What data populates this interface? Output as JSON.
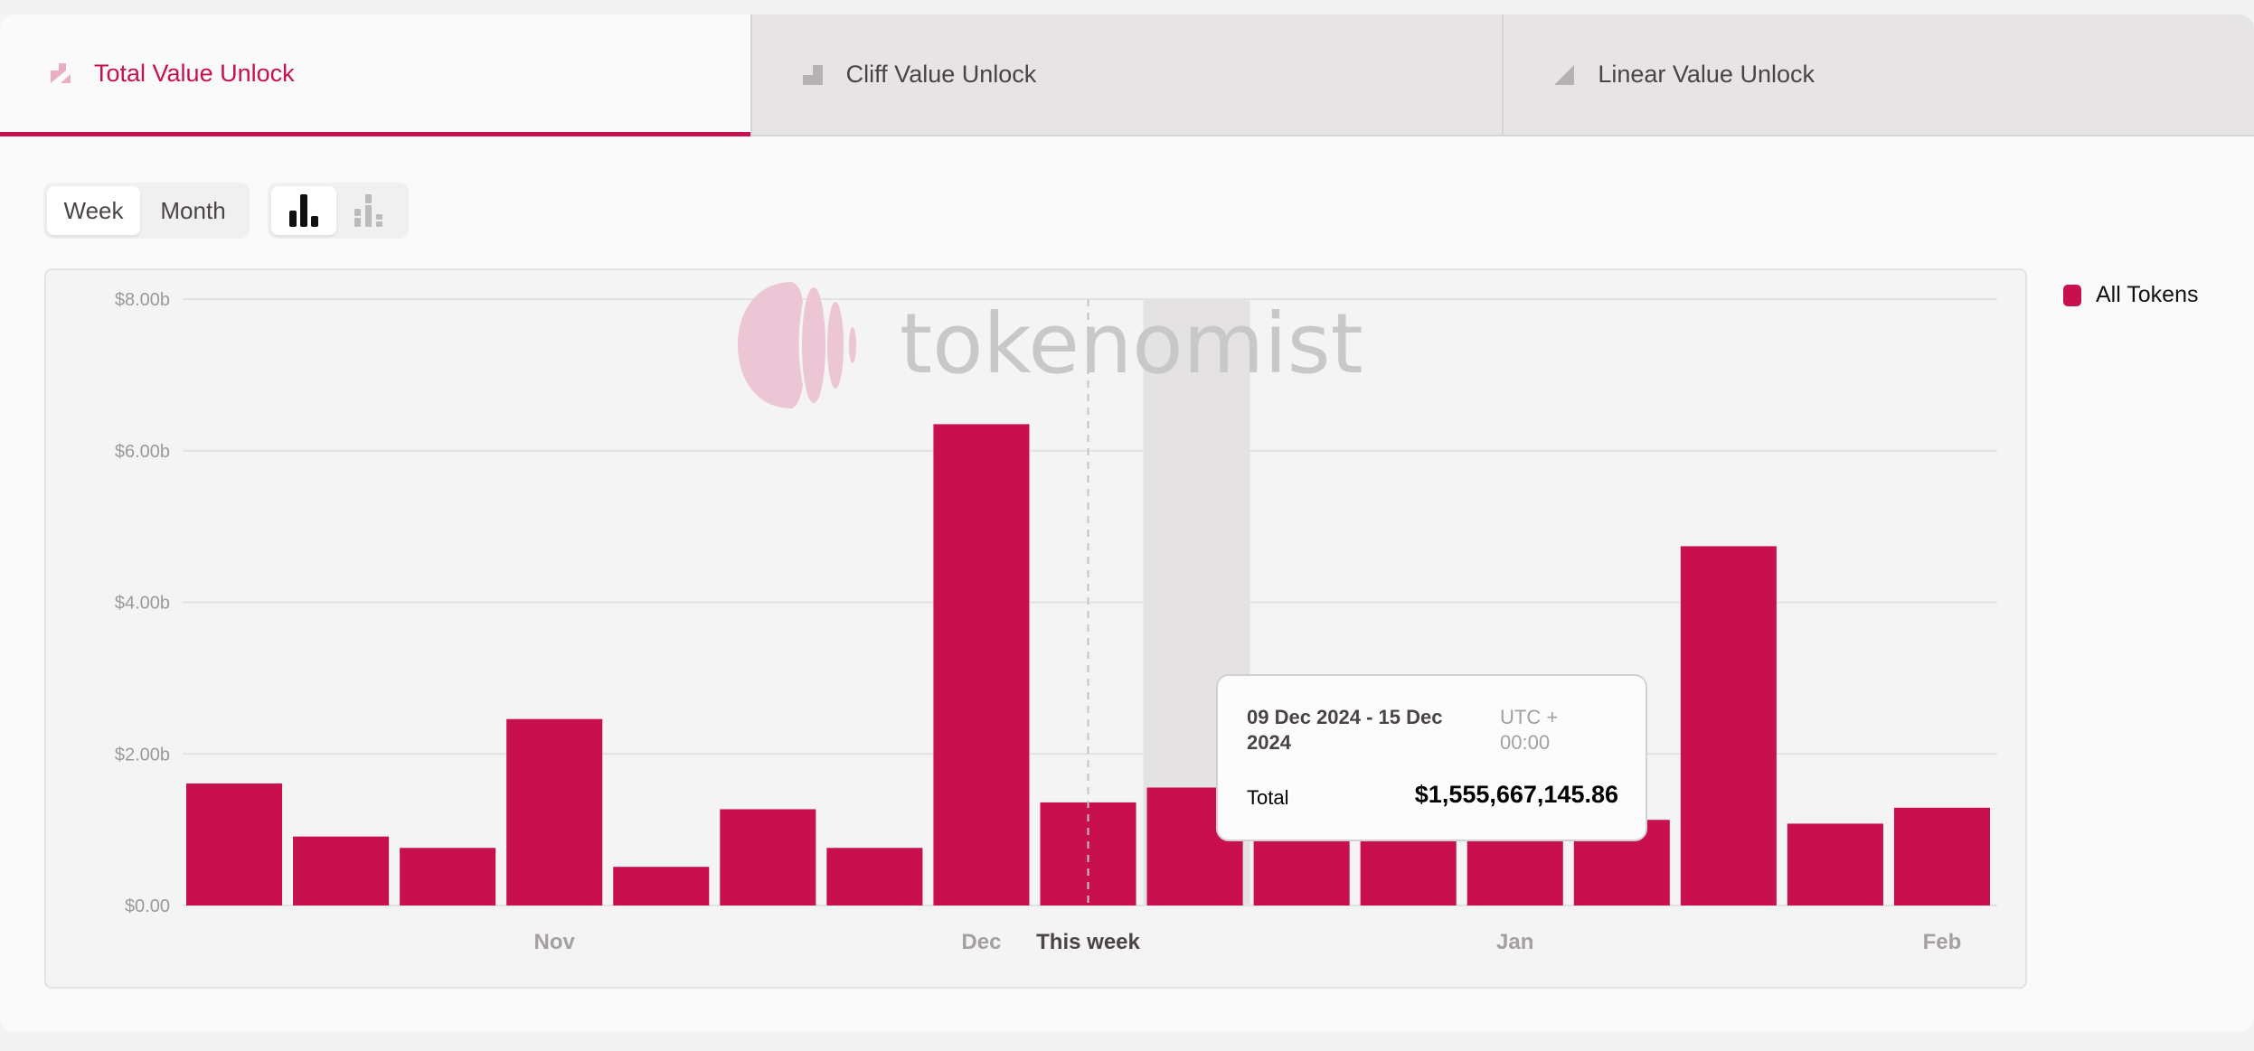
{
  "tabs": [
    {
      "label": "Total Value Unlock",
      "icon": "total-unlock-icon",
      "active": true
    },
    {
      "label": "Cliff Value Unlock",
      "icon": "cliff-unlock-icon",
      "active": false
    },
    {
      "label": "Linear Value Unlock",
      "icon": "linear-unlock-icon",
      "active": false
    }
  ],
  "period_toggle": {
    "options": [
      "Week",
      "Month"
    ],
    "selected": "Week"
  },
  "chart_type_toggle": {
    "options": [
      "bar-chart-icon",
      "stacked-bar-chart-icon"
    ],
    "selected": "bar-chart-icon"
  },
  "watermark": "tokenomist",
  "colors": {
    "accent": "#c8104f",
    "highlight": "#e4e2e3"
  },
  "legend": {
    "items": [
      {
        "label": "All Tokens",
        "color": "#c8104f"
      }
    ]
  },
  "tooltip": {
    "date_range": "09 Dec 2024 - 15 Dec 2024",
    "timezone": "UTC + 00:00",
    "label": "Total",
    "value": "$1,555,667,145.86"
  },
  "chart_data": {
    "type": "bar",
    "ylim": [
      0,
      8
    ],
    "y_unit": "billion USD",
    "y_ticks": [
      0,
      2,
      4,
      6,
      8
    ],
    "y_tick_labels": [
      "$0.00",
      "$2.00b",
      "$4.00b",
      "$6.00b",
      "$8.00b"
    ],
    "grid": true,
    "legend_position": "right",
    "x_tick_labels": [
      {
        "index": 3,
        "label": "Nov"
      },
      {
        "index": 7,
        "label": "Dec"
      },
      {
        "index": 8,
        "label": "This week",
        "current": true
      },
      {
        "index": 12,
        "label": "Jan"
      },
      {
        "index": 16,
        "label": "Feb"
      }
    ],
    "highlighted_index": 9,
    "series": [
      {
        "name": "All Tokens",
        "values": [
          1.61,
          0.91,
          0.76,
          2.46,
          0.51,
          1.27,
          0.76,
          6.35,
          1.36,
          1.556,
          1.25,
          0.97,
          1.2,
          1.13,
          4.74,
          1.08,
          1.29
        ]
      }
    ]
  }
}
